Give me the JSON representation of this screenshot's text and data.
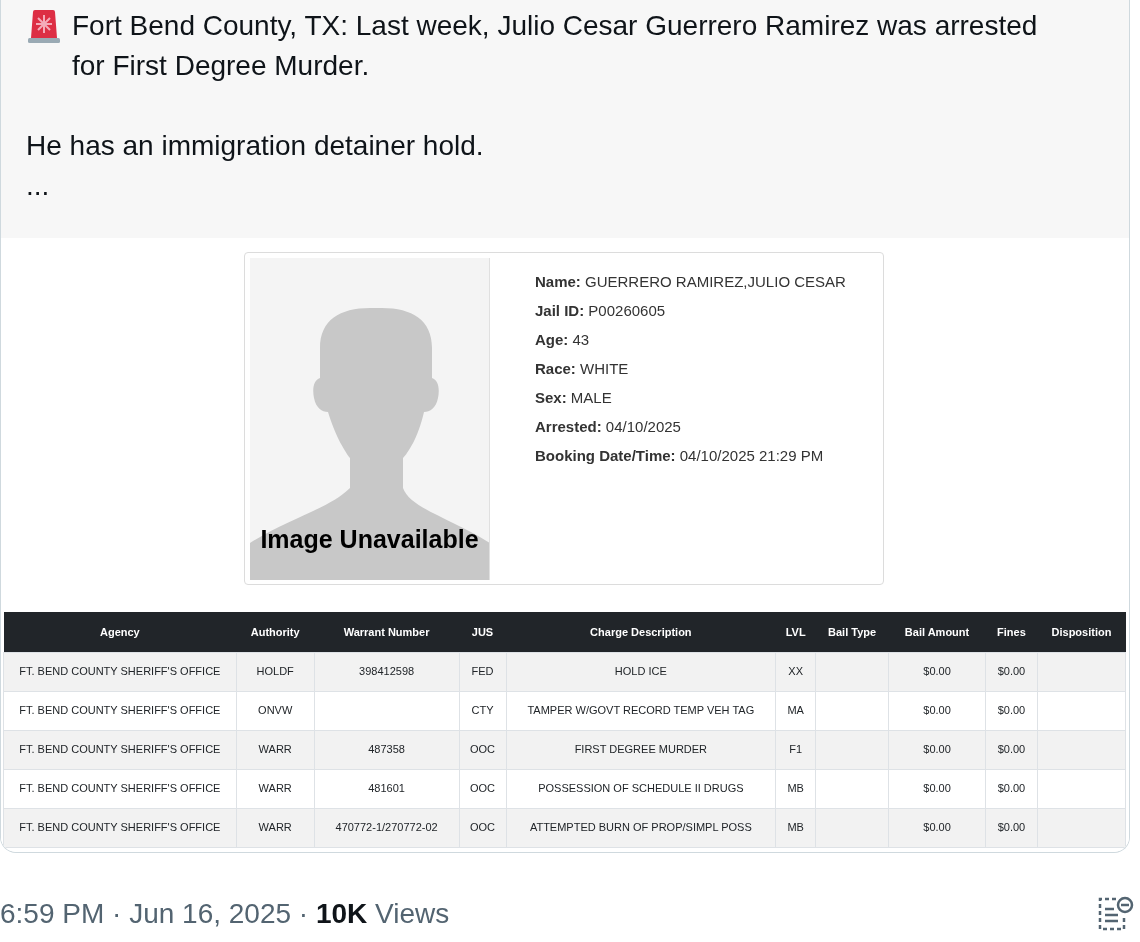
{
  "post": {
    "paragraphs": [
      "Fort Bend County, TX: Last week, Julio Cesar Guerrero Ramirez was arrested for First Degree Murder.",
      "He has an immigration detainer hold.",
      "..."
    ]
  },
  "record": {
    "photo_caption": "Image Unavailable",
    "fields": [
      "**Name:** GUERRERO RAMIREZ,JULIO CESAR",
      "**Jail ID:** P00260605",
      "**Age:** 43",
      "**Race:** WHITE",
      "**Sex:** MALE",
      "**Arrested:** 04/10/2025",
      "**Booking Date/Time:** 04/10/2025 21:29 PM"
    ]
  },
  "table": {
    "columns": [
      "Agency",
      "Authority",
      "Warrant Number",
      "JUS",
      "Charge Description",
      "LVL",
      "Bail Type",
      "Bail Amount",
      "Fines",
      "Disposition"
    ],
    "rows": [
      [
        "FT. BEND COUNTY SHERIFF'S OFFICE",
        "HOLDF",
        "398412598",
        "FED",
        "HOLD ICE",
        "XX",
        null,
        "$0.00",
        "$0.00",
        null
      ],
      [
        "FT. BEND COUNTY SHERIFF'S OFFICE",
        "ONVW",
        null,
        "CTY",
        "TAMPER W/GOVT RECORD TEMP VEH TAG",
        "MA",
        null,
        "$0.00",
        "$0.00",
        null
      ],
      [
        "FT. BEND COUNTY SHERIFF'S OFFICE",
        "WARR",
        "487358",
        "OOC",
        "FIRST DEGREE MURDER",
        "F1",
        null,
        "$0.00",
        "$0.00",
        null
      ],
      [
        "FT. BEND COUNTY SHERIFF'S OFFICE",
        "WARR",
        "481601",
        "OOC",
        "POSSESSION OF SCHEDULE II DRUGS",
        "MB",
        null,
        "$0.00",
        "$0.00",
        null
      ],
      [
        "FT. BEND COUNTY SHERIFF'S OFFICE",
        "WARR",
        "470772-1/270772-02",
        "OOC",
        "ATTEMPTED BURN OF PROP/SIMPL POSS",
        "MB",
        null,
        "$0.00",
        "$0.00",
        null
      ]
    ]
  },
  "footer": {
    "meta": "6:59 PM · Jun 16, 2025 · **10K** Views"
  }
}
